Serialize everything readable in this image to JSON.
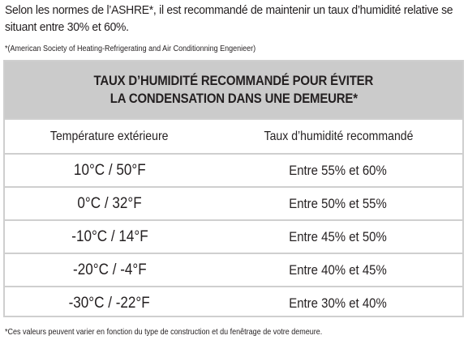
{
  "intro": {
    "line1": "Selon les normes de l’ASHRE*, il est recommandé de maintenir un taux d’humidité relative se",
    "line2": "situant entre 30% et 60%."
  },
  "footnote_top": "*(American Society of Heating-Refrigerating and Air Conditionning Engenieer)",
  "table": {
    "title_line1": "TAUX D’HUMIDITÉ RECOMMANDÉ POUR ÉVITER",
    "title_line2": "LA CONDENSATION DANS UNE DEMEURE*",
    "col_headers": [
      "Température extérieure",
      "Taux d’humidité recommandé"
    ],
    "rows": [
      {
        "temp": "10°C / 50°F",
        "humidity": "Entre 55% et 60%"
      },
      {
        "temp": "0°C / 32°F",
        "humidity": "Entre 50% et 55%"
      },
      {
        "temp": "-10°C / 14°F",
        "humidity": "Entre 45% et 50%"
      },
      {
        "temp": "-20°C / -4°F",
        "humidity": "Entre 40% et 45%"
      },
      {
        "temp": "-30°C / -22°F",
        "humidity": "Entre 30% et 40%"
      }
    ]
  },
  "footnote_bottom": "*Ces valeurs peuvent varier en fonction du type de construction et du fenêtrage de votre demeure.",
  "colors": {
    "header_bg": "#cbcbcb",
    "border": "#cfcfcf",
    "text": "#231f20"
  }
}
